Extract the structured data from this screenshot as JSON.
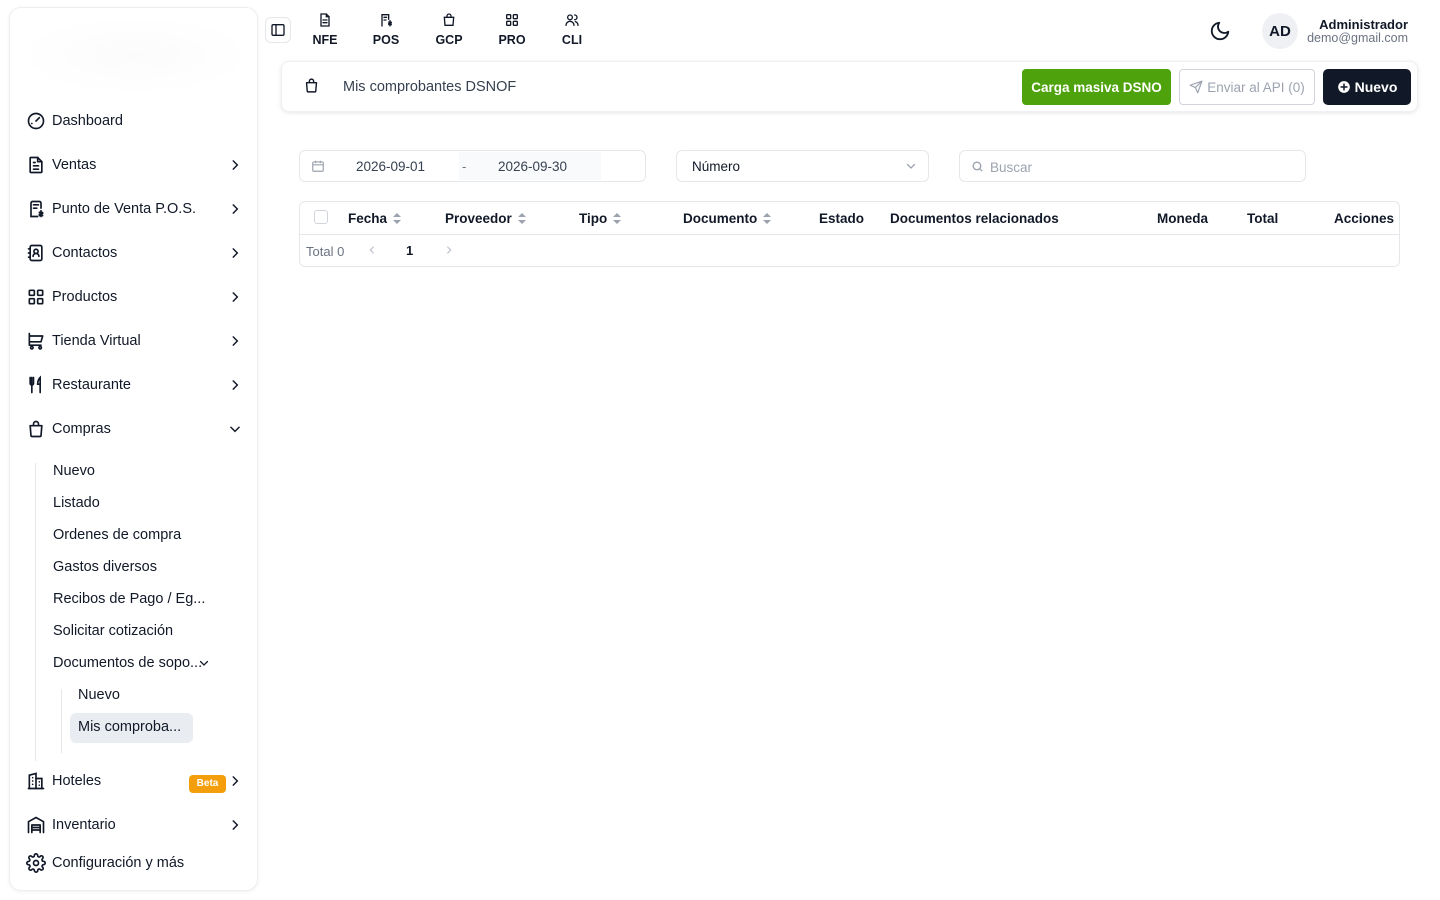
{
  "sidebar": {
    "items": [
      {
        "label": "Dashboard",
        "icon": "gauge-icon"
      },
      {
        "label": "Ventas",
        "icon": "document-icon"
      },
      {
        "label": "Punto de Venta P.O.S.",
        "icon": "receipt-icon"
      },
      {
        "label": "Contactos",
        "icon": "contacts-icon"
      },
      {
        "label": "Productos",
        "icon": "grid-icon"
      },
      {
        "label": "Tienda Virtual",
        "icon": "cart-icon"
      },
      {
        "label": "Restaurante",
        "icon": "utensils-icon"
      },
      {
        "label": "Compras",
        "icon": "shopping-bag-icon"
      },
      {
        "label": "Hoteles",
        "icon": "building-icon",
        "badge": "Beta"
      },
      {
        "label": "Inventario",
        "icon": "warehouse-icon"
      },
      {
        "label": "Configuración y más",
        "icon": "gear-icon"
      }
    ],
    "compras_sub": [
      "Nuevo",
      "Listado",
      "Ordenes de compra",
      "Gastos diversos",
      "Recibos de Pago / Eg...",
      "Solicitar cotización",
      "Documentos de sopo..."
    ],
    "documentos_sub": [
      "Nuevo",
      "Mis comproba..."
    ]
  },
  "topbar": {
    "tabs": [
      "NFE",
      "POS",
      "GCP",
      "PRO",
      "CLI"
    ],
    "avatar_initials": "AD",
    "user_name": "Administrador",
    "user_email": "demo@gmail.com"
  },
  "header": {
    "title": "Mis comprobantes DSNOF",
    "btn_carga": "Carga masiva DSNO",
    "btn_enviar": "Enviar al API (0)",
    "btn_nuevo": "Nuevo"
  },
  "filters": {
    "date_from": "2026-09-01",
    "date_sep": "-",
    "date_to": "2026-09-30",
    "select_value": "Número",
    "search_placeholder": "Buscar"
  },
  "table": {
    "columns": [
      "Fecha",
      "Proveedor",
      "Tipo",
      "Documento",
      "Estado",
      "Documentos relacionados",
      "Moneda",
      "Total",
      "Acciones"
    ],
    "total_label": "Total 0",
    "current_page": "1"
  },
  "colors": {
    "green": "#4ea30c",
    "dark": "#111827",
    "badge": "#f59e0b"
  }
}
